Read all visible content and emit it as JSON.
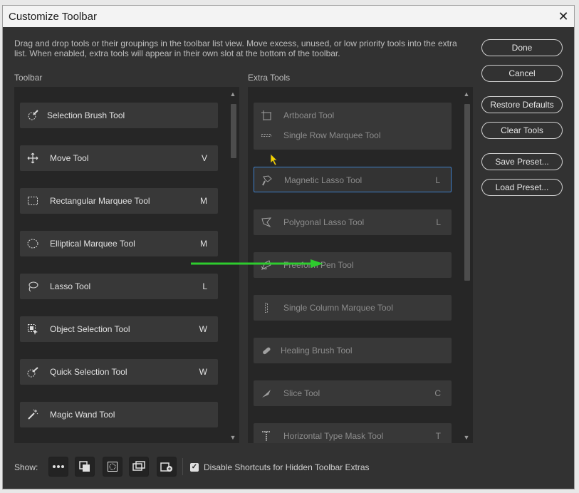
{
  "dialog": {
    "title": "Customize Toolbar",
    "close_glyph": "✕",
    "description": "Drag and drop tools or their groupings in the toolbar list view. Move excess, unused, or low priority tools into the extra list. When enabled, extra tools will appear in their own slot at the bottom of the toolbar."
  },
  "toolbar_column": {
    "heading": "Toolbar",
    "items": [
      {
        "label": "Selection Brush Tool",
        "key": "",
        "icon": "selection-brush-icon"
      },
      {
        "label": "Move Tool",
        "key": "V",
        "icon": "move-icon"
      },
      {
        "label": "Rectangular Marquee Tool",
        "key": "M",
        "icon": "rectangular-marquee-icon"
      },
      {
        "label": "Elliptical Marquee Tool",
        "key": "M",
        "icon": "elliptical-marquee-icon"
      },
      {
        "label": "Lasso Tool",
        "key": "L",
        "icon": "lasso-icon"
      },
      {
        "label": "Object Selection Tool",
        "key": "W",
        "icon": "object-selection-icon"
      },
      {
        "label": "Quick Selection Tool",
        "key": "W",
        "icon": "quick-selection-icon"
      },
      {
        "label": "Magic Wand Tool",
        "key": "",
        "icon": "magic-wand-icon"
      }
    ]
  },
  "extra_column": {
    "heading": "Extra Tools",
    "group1": [
      {
        "label": "Artboard Tool",
        "key": "",
        "icon": "artboard-icon"
      },
      {
        "label": "Single Row Marquee Tool",
        "key": "",
        "icon": "single-row-marquee-icon"
      }
    ],
    "items": [
      {
        "label": "Magnetic Lasso Tool",
        "key": "L",
        "icon": "magnetic-lasso-icon"
      },
      {
        "label": "Polygonal Lasso Tool",
        "key": "L",
        "icon": "polygonal-lasso-icon"
      },
      {
        "label": "Freeform Pen Tool",
        "key": "",
        "icon": "freeform-pen-icon"
      },
      {
        "label": "Single Column Marquee Tool",
        "key": "",
        "icon": "single-column-marquee-icon"
      },
      {
        "label": "Healing Brush Tool",
        "key": "",
        "icon": "healing-brush-icon"
      },
      {
        "label": "Slice Tool",
        "key": "C",
        "icon": "slice-icon"
      },
      {
        "label": "Horizontal Type Mask Tool",
        "key": "T",
        "icon": "horizontal-type-mask-icon"
      }
    ]
  },
  "buttons": {
    "done": "Done",
    "cancel": "Cancel",
    "restore_defaults": "Restore Defaults",
    "clear_tools": "Clear Tools",
    "save_preset": "Save Preset...",
    "load_preset": "Load Preset..."
  },
  "footer": {
    "show_label": "Show:",
    "checkbox_label": "Disable Shortcuts for Hidden Toolbar Extras",
    "checkbox_checked": true,
    "checkbox_mark": "✓"
  },
  "scroll_arrows": {
    "up": "▲",
    "down": "▼"
  },
  "colors": {
    "accent_arrow": "#2ecc2e",
    "selection_border": "#3e7fc9"
  }
}
